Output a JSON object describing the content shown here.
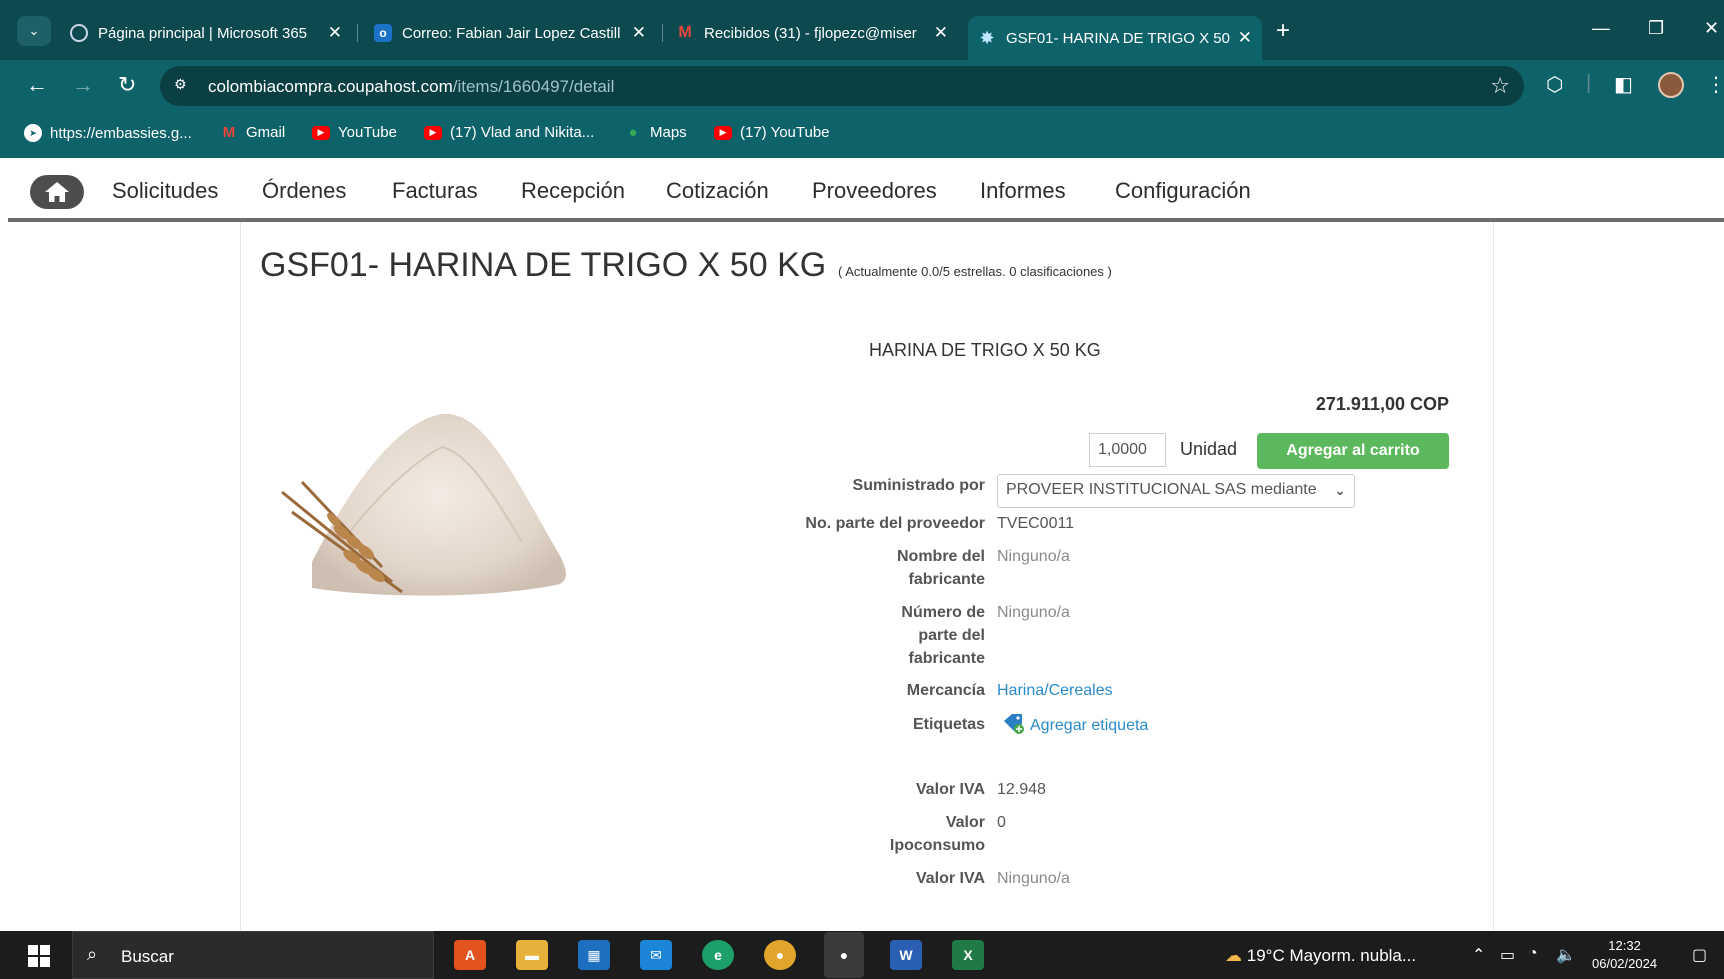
{
  "browser": {
    "tabs": [
      {
        "title": "Página principal | Microsoft 365",
        "icon": "m365-icon",
        "active": false
      },
      {
        "title": "Correo: Fabian Jair Lopez Castill",
        "icon": "outlook-icon",
        "active": false
      },
      {
        "title": "Recibidos (31) - fjlopezc@miser",
        "icon": "gmail-icon",
        "active": false
      },
      {
        "title": "GSF01- HARINA DE TRIGO X 50",
        "icon": "coupa-icon",
        "active": true
      }
    ],
    "url_host": "colombiacompra.coupahost.com",
    "url_path": "/items/1660497/detail",
    "bookmarks": [
      {
        "label": "https://embassies.g...",
        "icon": "globe-icon"
      },
      {
        "label": "Gmail",
        "icon": "gmail-icon"
      },
      {
        "label": "YouTube",
        "icon": "youtube-icon"
      },
      {
        "label": "(17) Vlad and Nikita...",
        "icon": "youtube-icon"
      },
      {
        "label": "Maps",
        "icon": "maps-icon"
      },
      {
        "label": "(17) YouTube",
        "icon": "youtube-icon"
      }
    ]
  },
  "nav": {
    "items": [
      "Solicitudes",
      "Órdenes",
      "Facturas",
      "Recepción",
      "Cotización",
      "Proveedores",
      "Informes",
      "Configuración"
    ]
  },
  "item": {
    "title": "GSF01- HARINA DE TRIGO X 50 KG",
    "rating": "( Actualmente 0.0/5 estrellas. 0 clasificaciones )",
    "description": "HARINA DE TRIGO X 50 KG",
    "price": "271.911,00 COP",
    "quantity": "1,0000",
    "unit": "Unidad",
    "add_to_cart": "Agregar al carrito",
    "fields": {
      "supplied_by_label": "Suministrado por",
      "supplied_by_value": "PROVEER INSTITUCIONAL SAS mediante",
      "supplier_part_label": "No. parte del proveedor",
      "supplier_part_value": "TVEC0011",
      "manufacturer_name_label_1": "Nombre del",
      "manufacturer_name_label_2": "fabricante",
      "manufacturer_name_value": "Ninguno/a",
      "manufacturer_part_label_1": "Número de",
      "manufacturer_part_label_2": "parte del",
      "manufacturer_part_label_3": "fabricante",
      "manufacturer_part_value": "Ninguno/a",
      "commodity_label": "Mercancía",
      "commodity_value": "Harina/Cereales",
      "tags_label": "Etiquetas",
      "tags_value": "Agregar etiqueta",
      "iva_label": "Valor IVA",
      "iva_value": "12.948",
      "ipoconsumo_label_1": "Valor",
      "ipoconsumo_label_2": "Ipoconsumo",
      "ipoconsumo_value": "0",
      "iva2_label": "Valor IVA",
      "iva2_value": "Ninguno/a"
    }
  },
  "taskbar": {
    "search_placeholder": "Buscar",
    "weather": "19°C  Mayorm. nubla...",
    "time": "12:32",
    "date": "06/02/2024"
  }
}
